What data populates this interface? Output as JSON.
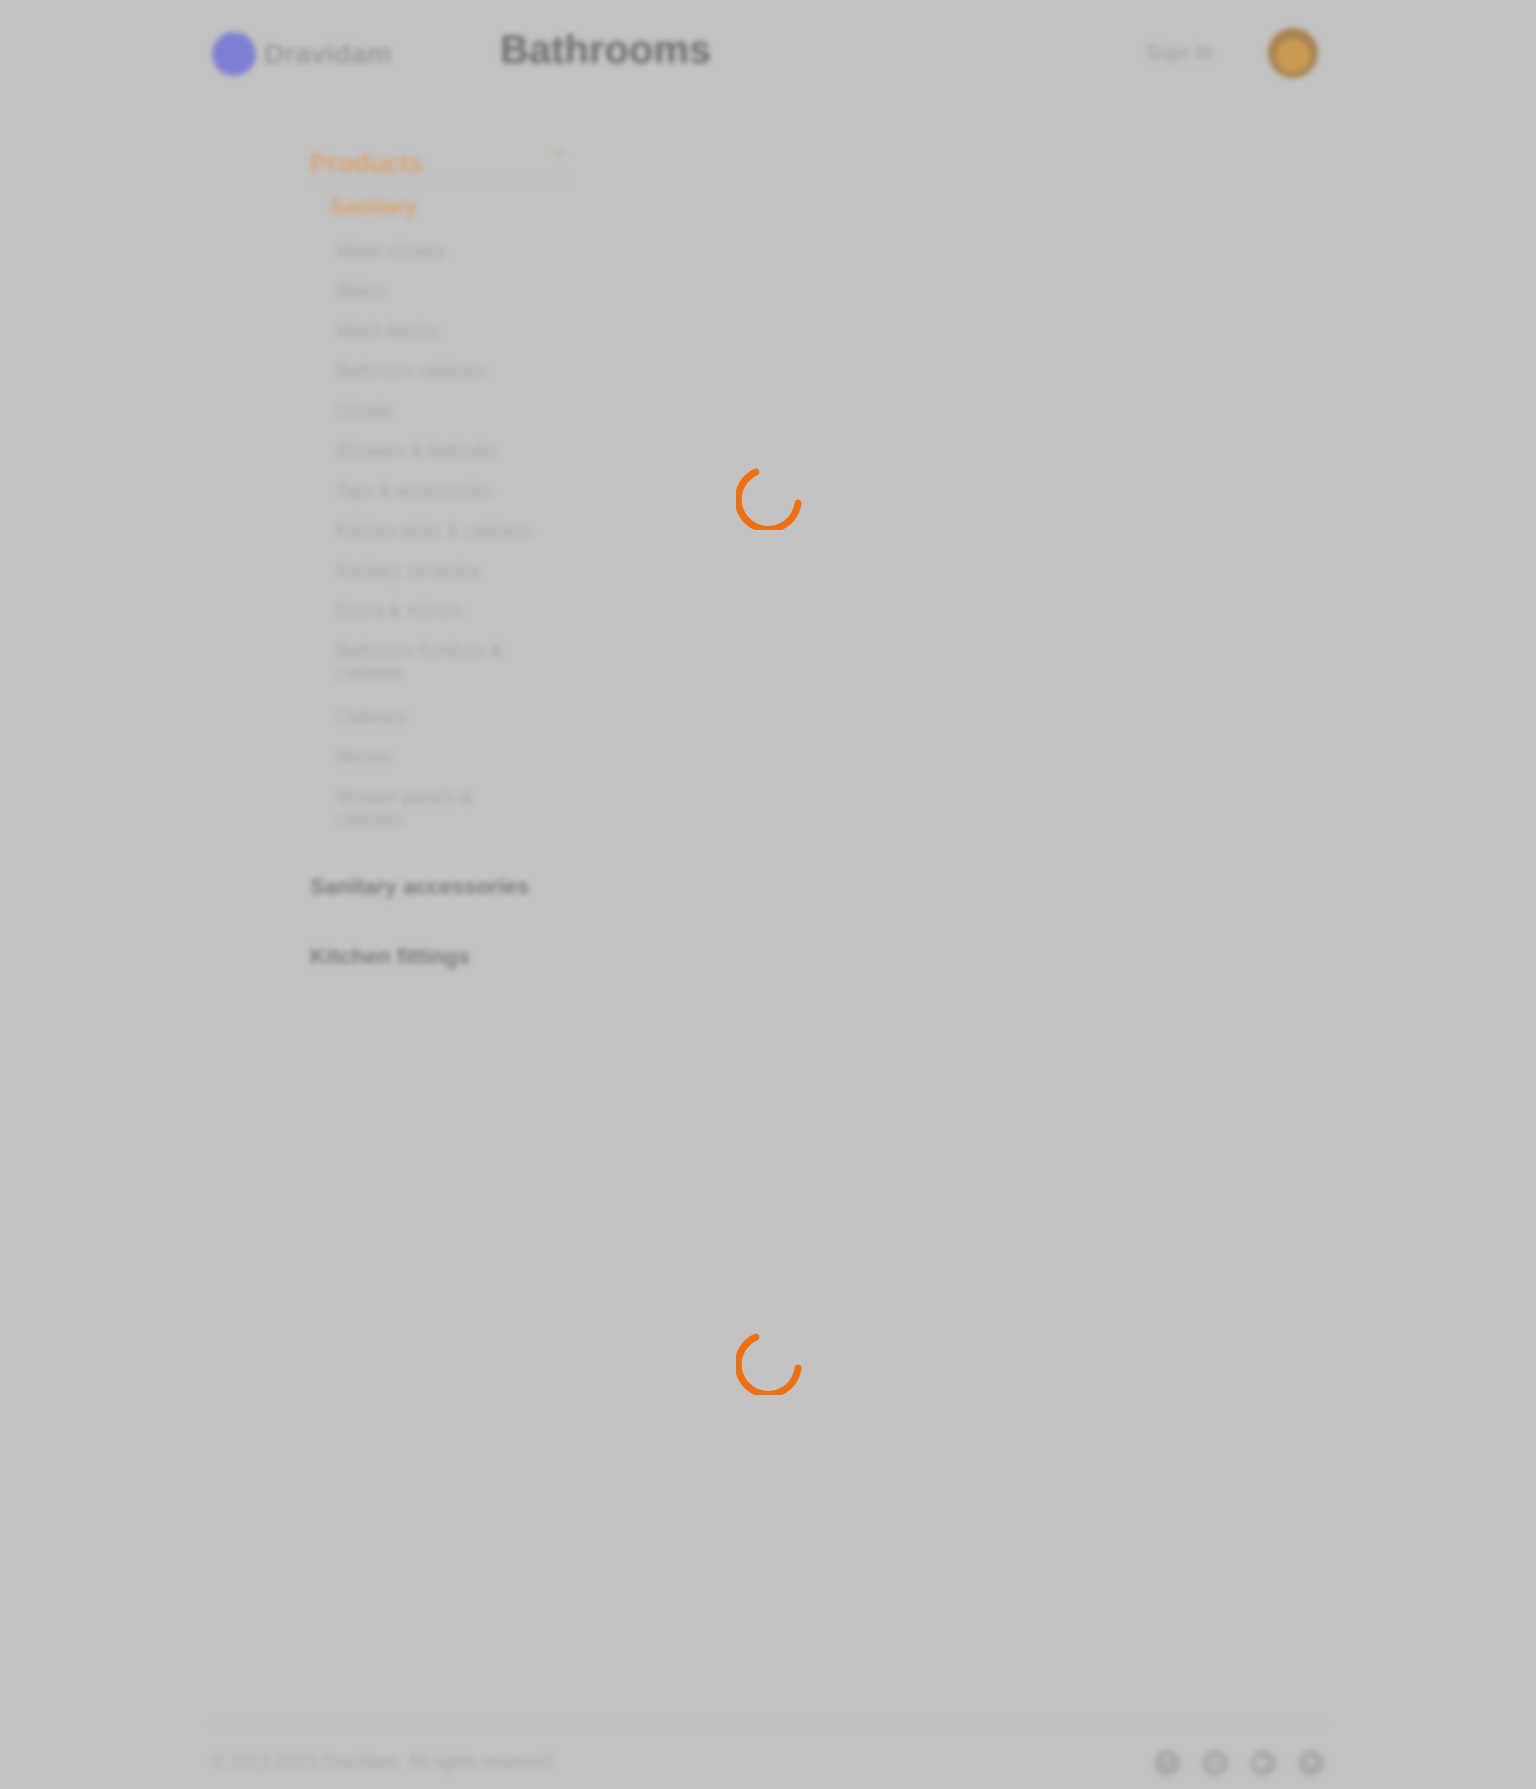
{
  "header": {
    "logo_text": "Dravidam",
    "page_heading": "Bathrooms",
    "signin_label": "Sign In",
    "avatar_icon": "user-avatar"
  },
  "sidebar": {
    "active_category": "Products",
    "sub_items": [
      "Sanitary",
      "Water closets",
      "Bidets",
      "Wash basins",
      "Bathroom cabinets",
      "Urinals",
      "Showers & bathtubs",
      "Taps & accessories",
      "Kitchen sinks & cabinets",
      "Sanitary ceramics",
      "Doors & mirrors",
      "Bathroom furniture & cabinets",
      "Cabinets",
      "Mirrors",
      "Shower panels & cabinets"
    ],
    "collapsed_categories": [
      "Sanitary accessories",
      "Kitchen fittings"
    ]
  },
  "footer": {
    "copyright": "© 2012-2023 Dravidam. All rights reserved.",
    "social_icons": [
      "facebook-icon",
      "instagram-icon",
      "youtube-icon",
      "telegram-icon"
    ]
  },
  "colors": {
    "accent": "#f07010",
    "overlay": "#c3c3c3"
  }
}
